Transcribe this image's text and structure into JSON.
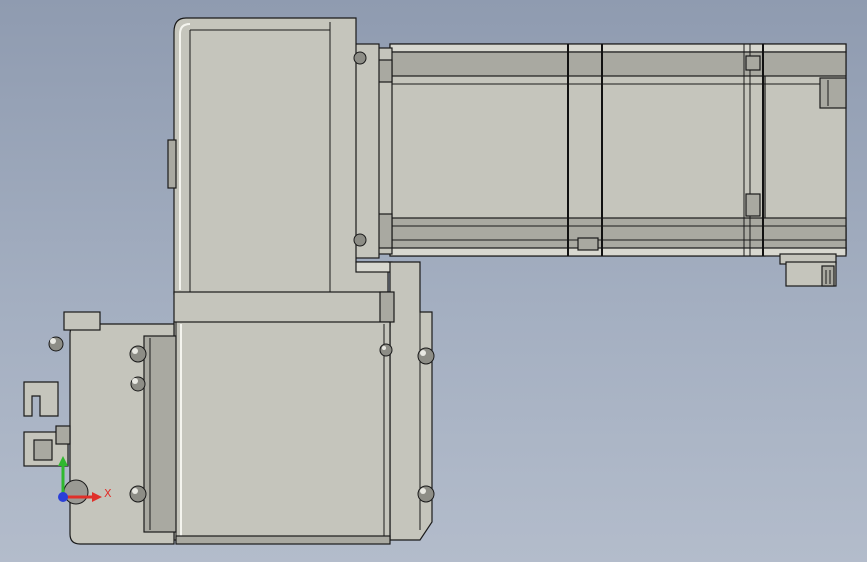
{
  "viewport": {
    "background_top": "#8f9bb0",
    "background_bottom": "#b3bccb",
    "part_color": "#c5c5bc",
    "edge_color": "#1a1a1a"
  },
  "triad": {
    "x_label": "X",
    "y_label": "",
    "z_label": "",
    "x_color": "#e0302a",
    "y_color": "#2fb82f",
    "z_color": "#2a3fd8"
  }
}
